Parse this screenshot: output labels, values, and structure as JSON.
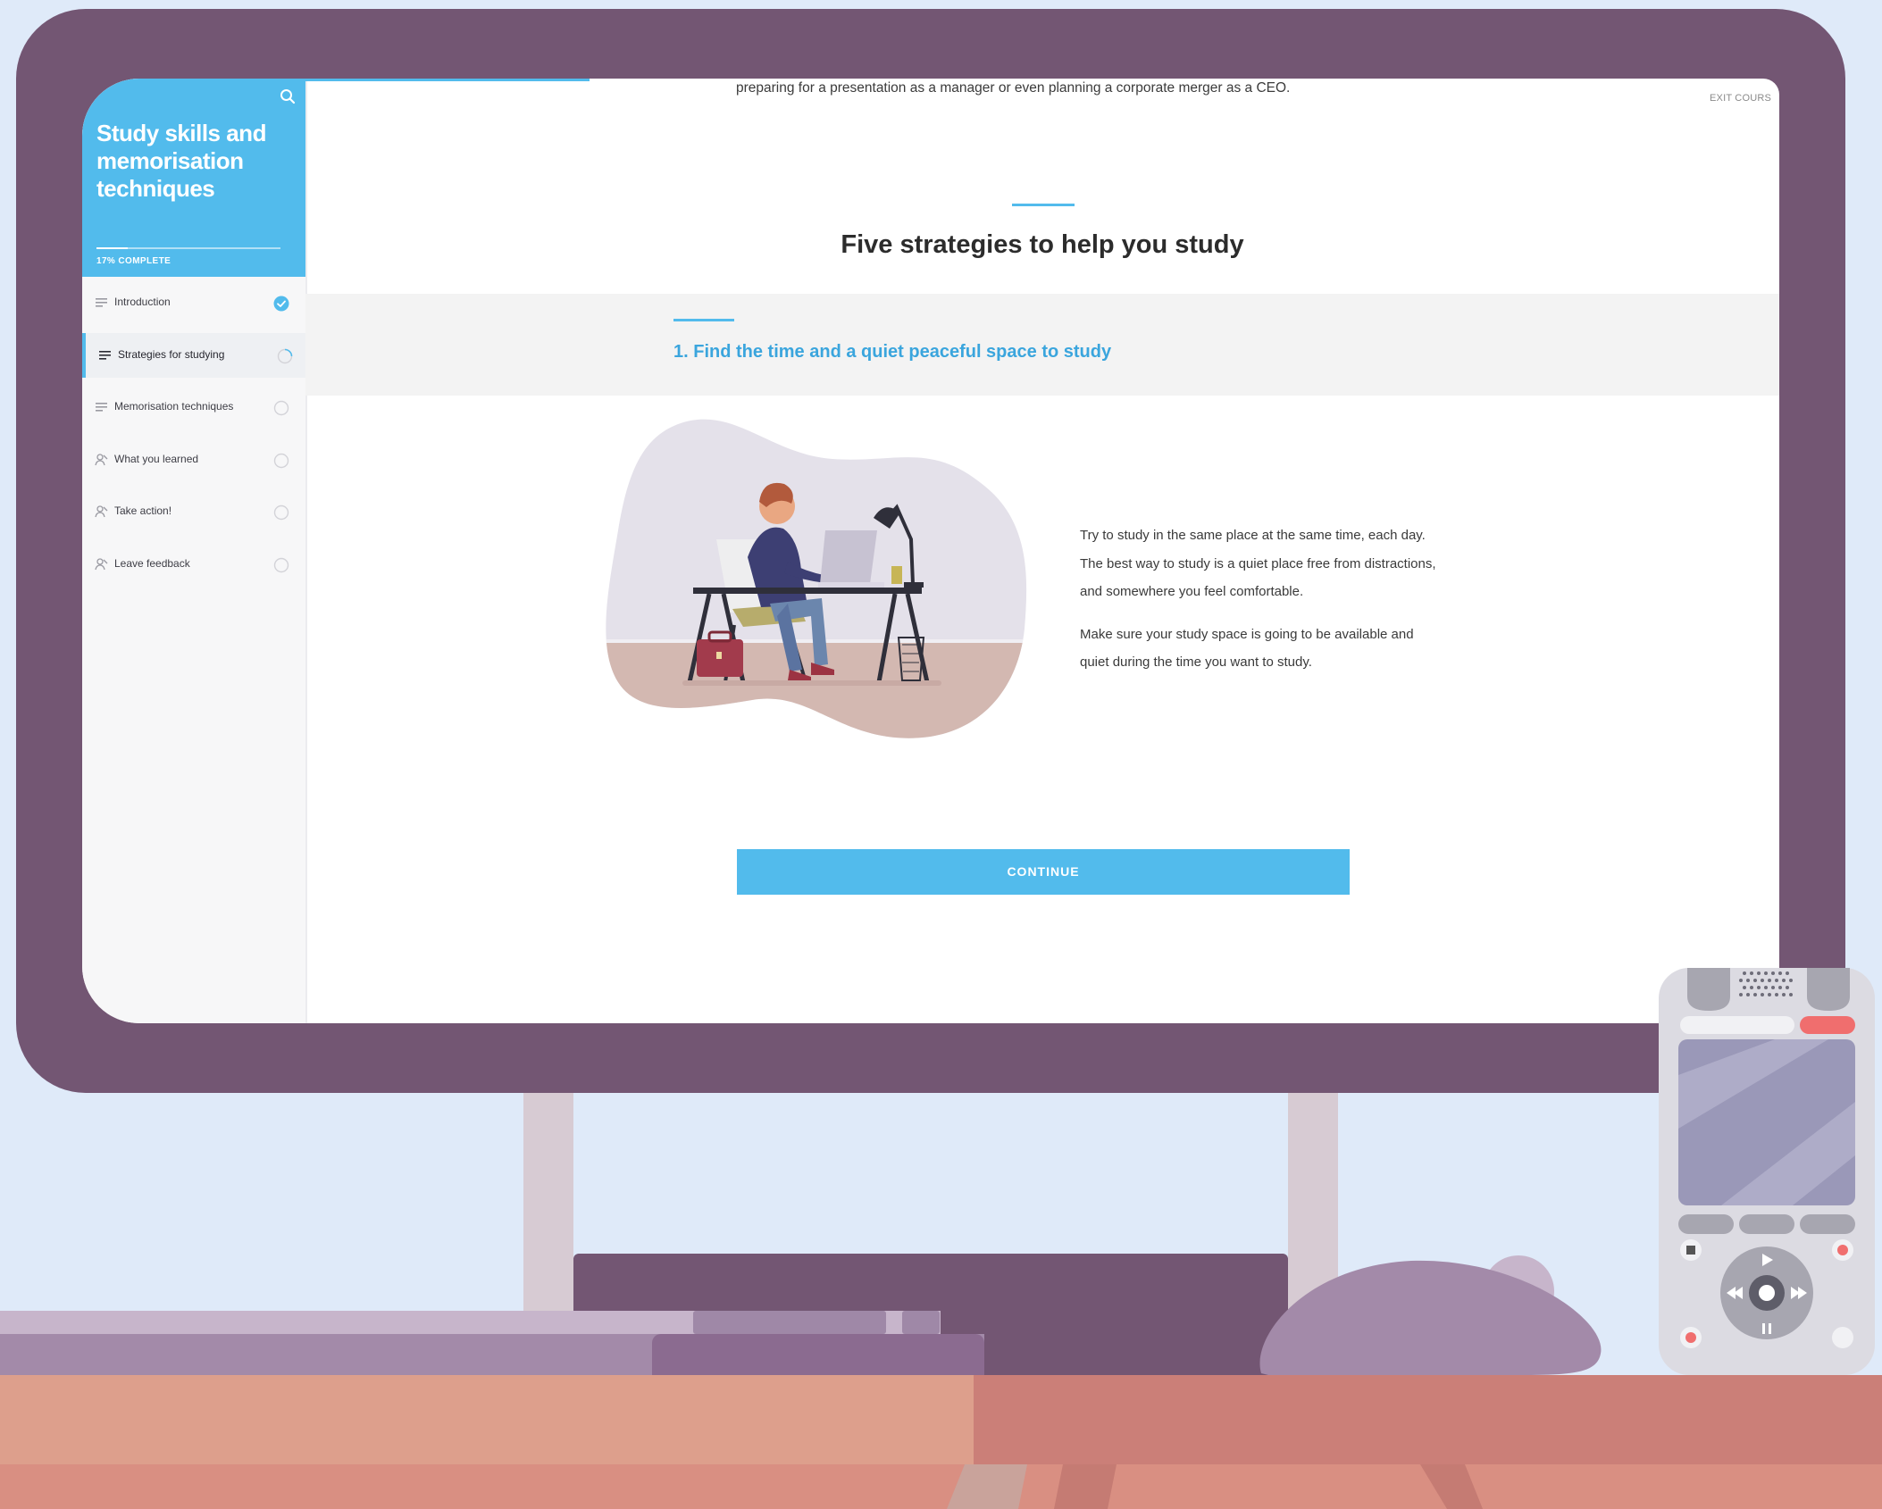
{
  "course": {
    "title": "Study skills and memorisation techniques",
    "progress_label": "17% COMPLETE",
    "progress_fraction": 0.17
  },
  "sidebar": {
    "items": [
      {
        "label": "Introduction",
        "icon": "lines-icon",
        "status": "complete"
      },
      {
        "label": "Strategies for studying",
        "icon": "lines-icon",
        "status": "in-progress"
      },
      {
        "label": "Memorisation techniques",
        "icon": "lines-icon",
        "status": "not-started"
      },
      {
        "label": "What you learned",
        "icon": "person-icon",
        "status": "not-started"
      },
      {
        "label": "Take action!",
        "icon": "person-icon",
        "status": "not-started"
      },
      {
        "label": "Leave feedback",
        "icon": "person-icon",
        "status": "not-started"
      }
    ]
  },
  "main": {
    "intro_text": "preparing for a presentation as a manager or even planning a corporate merger as a CEO.",
    "exit_label": "EXIT COURS",
    "section_heading": "Five strategies to help you study",
    "subsection_title": "1. Find the time and a quiet peaceful space to study",
    "paragraphs": [
      "Try to study in the same place at the same time, each day. The best way to study is a quiet place free from distractions, and somewhere you feel comfortable.",
      "Make sure your study space is going to be available and quiet during the time you want to study."
    ],
    "continue_label": "CONTINUE"
  },
  "colors": {
    "accent": "#52bbec",
    "monitor": "#735673",
    "background": "#dfeaf9",
    "desk": "#dd9f8c"
  }
}
